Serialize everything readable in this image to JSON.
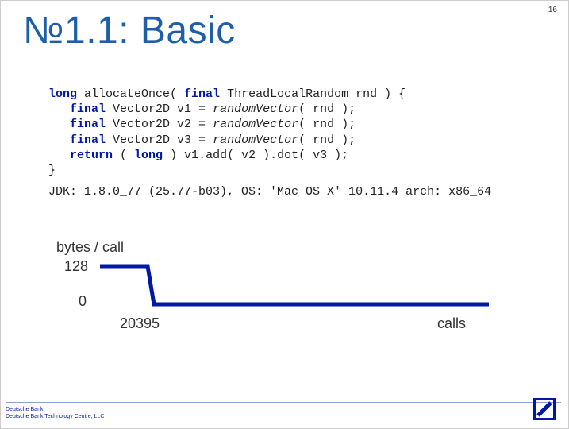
{
  "page_number": "16",
  "title": "№1.1: Basic",
  "code": {
    "l1a": "long",
    "l1b": " allocateOnce( ",
    "l1c": "final",
    "l1d": " ThreadLocalRandom rnd ) {",
    "l2a": "   ",
    "l2b": "final",
    "l2c": " Vector2D v1 = ",
    "l2d": "randomVector",
    "l2e": "( rnd );",
    "l3a": "   ",
    "l3b": "final",
    "l3c": " Vector2D v2 = ",
    "l3d": "randomVector",
    "l3e": "( rnd );",
    "l4a": "   ",
    "l4b": "final",
    "l4c": " Vector2D v3 = ",
    "l4d": "randomVector",
    "l4e": "( rnd );",
    "l5a": "   ",
    "l5b": "return",
    "l5c": " ( ",
    "l5d": "long",
    "l5e": " ) v1.add( v2 ).dot( v3 );",
    "l6": "}"
  },
  "env": "JDK: 1.8.0_77 (25.77-b03), OS: 'Mac OS X' 10.11.4 arch: x86_64",
  "chart_data": {
    "type": "line",
    "xlabel": "calls",
    "ylabel": "bytes / call",
    "ylim": [
      0,
      128
    ],
    "yticks": {
      "lo": "0",
      "hi": "128"
    },
    "x_threshold_label": "20395",
    "series": [
      {
        "name": "bytes-per-call",
        "segments": [
          {
            "from_x": 0,
            "to_x": 20395,
            "y": 128
          },
          {
            "from_x": 20395,
            "to_x": 200000,
            "y": 0
          }
        ]
      }
    ]
  },
  "footer": {
    "line1": "Deutsche Bank",
    "line2": "Deutsche Bank Technology Centre, LLC"
  }
}
